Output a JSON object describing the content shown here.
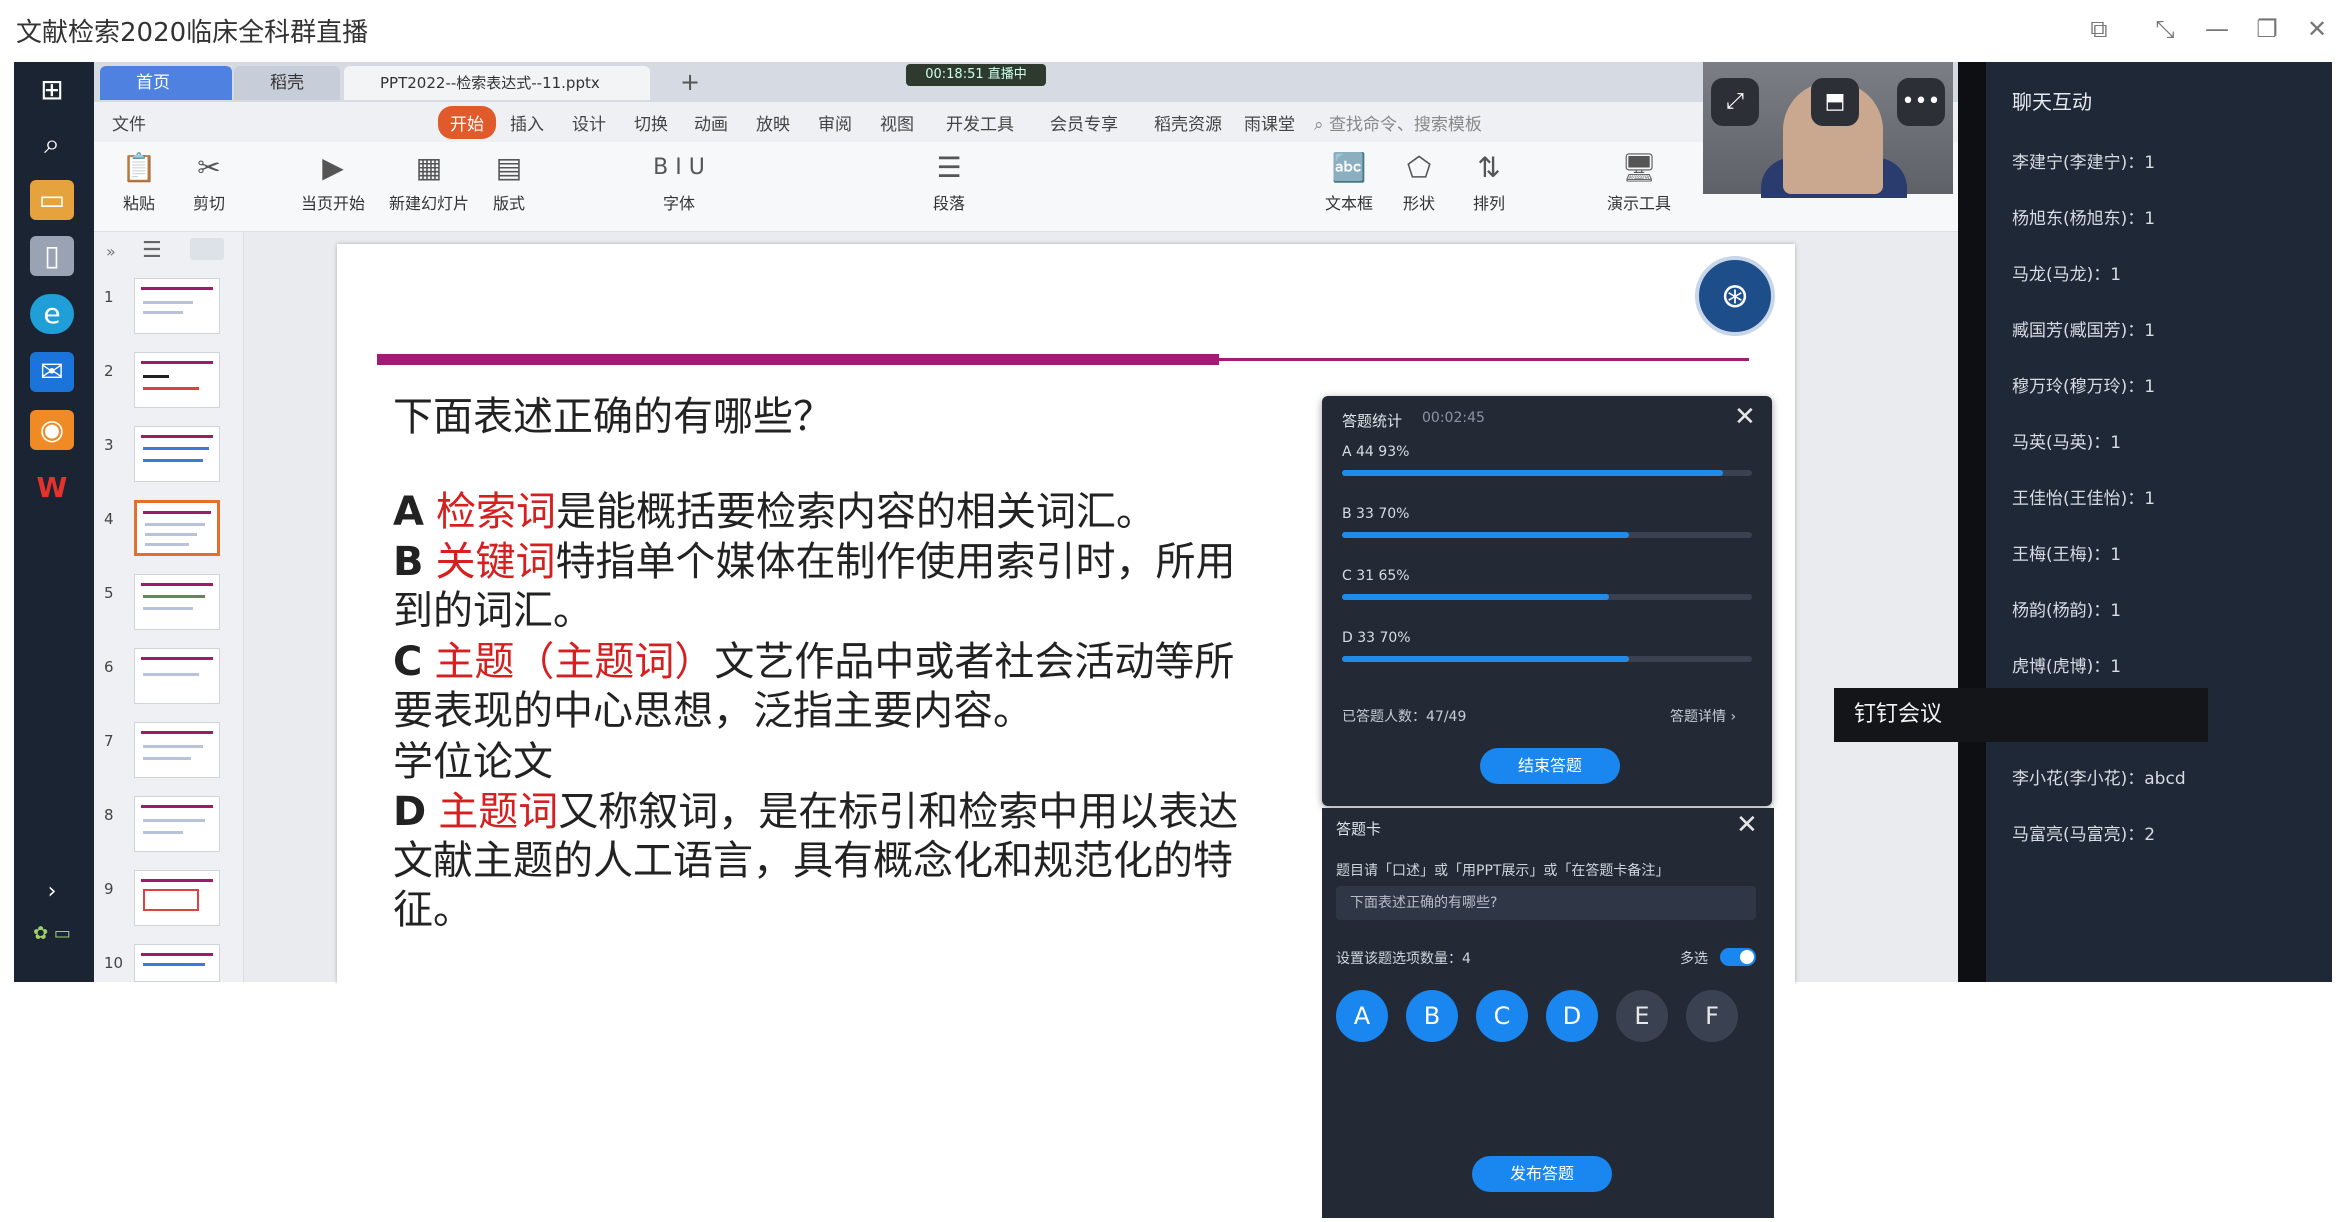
{
  "window": {
    "title": "文献检索2020临床全科群直播",
    "controls": [
      "⧉",
      "⤡",
      "—",
      "❐",
      "✕"
    ]
  },
  "taskbar": {
    "icons": [
      "windows-logo-icon",
      "search-icon",
      "folder-icon",
      "file-icon",
      "edge-icon",
      "mail-icon",
      "app-icon",
      "wps-icon"
    ]
  },
  "wps": {
    "tabs": [
      "首页",
      "稻壳",
      "PPT2022--检索表达式--11.pptx"
    ],
    "add_tab": "+",
    "timer": "00:18:51  直播中",
    "menu": [
      "文件",
      "开始",
      "插入",
      "设计",
      "切换",
      "动画",
      "放映",
      "审阅",
      "视图",
      "开发工具",
      "会员专享",
      "稻壳资源",
      "雨课堂",
      "查找命令、搜索模板"
    ],
    "ribbon": [
      {
        "icon": "📋",
        "label": "粘贴"
      },
      {
        "icon": "✂",
        "label": "剪切"
      },
      {
        "icon": "▶",
        "label": "当页开始"
      },
      {
        "icon": "▦",
        "label": "新建幻灯片"
      },
      {
        "icon": "▤",
        "label": "版式"
      },
      {
        "icon": "B I U",
        "label": "字体"
      },
      {
        "icon": "☰",
        "label": "段落"
      },
      {
        "icon": "🔤",
        "label": "文本框"
      },
      {
        "icon": "⬠",
        "label": "形状"
      },
      {
        "icon": "⇅",
        "label": "排列"
      },
      {
        "icon": "🖥",
        "label": "演示工具"
      }
    ],
    "thumb_numbers": [
      "1",
      "2",
      "3",
      "4",
      "5",
      "6",
      "7",
      "8",
      "9",
      "10"
    ],
    "selected_thumb": 4
  },
  "slide": {
    "question": "下面表述正确的有哪些？",
    "options": [
      {
        "letter": "A",
        "keyword": "检索词",
        "text": "是能概括要检索内容的相关词汇。"
      },
      {
        "letter": "B",
        "keyword": "关键词",
        "text": "特指单个媒体在制作使用索引时，所用到的词汇。"
      },
      {
        "letter": "C",
        "keyword": "主题（主题词）",
        "text": "文艺作品中或者社会活动等所要表现的中心思想，泛指主要内容。"
      },
      {
        "letter": "",
        "keyword": "",
        "text": "学位论文"
      },
      {
        "letter": "D",
        "keyword": "主题词",
        "text": "又称叙词，是在标引和检索中用以表达文献主题的人工语言，具有概念化和规范化的特征。"
      }
    ]
  },
  "video": {
    "buttons": [
      "⤢",
      "⬒",
      "•••"
    ]
  },
  "chat": {
    "title": "聊天互动",
    "messages": [
      "李建宁(李建宁)：1",
      "杨旭东(杨旭东)：1",
      "马龙(马龙)：1",
      "臧国芳(臧国芳)：1",
      "穆万玲(穆万玲)：1",
      "马英(马英)：1",
      "王佳怡(王佳怡)：1",
      "王梅(王梅)：1",
      "杨韵(杨韵)：1",
      "虎博(虎博)：1",
      "",
      "李小花(李小花)：abcd",
      "马富亮(马富亮)：2"
    ],
    "tooltip": "钉钉会议"
  },
  "stats": {
    "title": "答题统计",
    "elapsed": "00:02:45",
    "close": "✕",
    "rows": [
      {
        "label": "A  44  93%",
        "percent": 93
      },
      {
        "label": "B  33  70%",
        "percent": 70
      },
      {
        "label": "C  31  65%",
        "percent": 65
      },
      {
        "label": "D  33  70%",
        "percent": 70
      }
    ],
    "answered_label": "已答题人数：47/49",
    "detail_link": "答题详情 ›",
    "end_button": "结束答题"
  },
  "card": {
    "title": "答题卡",
    "close": "✕",
    "hint": "题目请「口述」或「用PPT展示」或「在答题卡备注」",
    "input_value": "下面表述正确的有哪些?",
    "count_label": "设置该题选项数量：4",
    "multi_label": "多选",
    "multi_on": true,
    "choices": [
      {
        "letter": "A",
        "selected": true
      },
      {
        "letter": "B",
        "selected": true
      },
      {
        "letter": "C",
        "selected": true
      },
      {
        "letter": "D",
        "selected": true
      },
      {
        "letter": "E",
        "selected": false
      },
      {
        "letter": "F",
        "selected": false
      }
    ],
    "publish_button": "发布答题"
  }
}
